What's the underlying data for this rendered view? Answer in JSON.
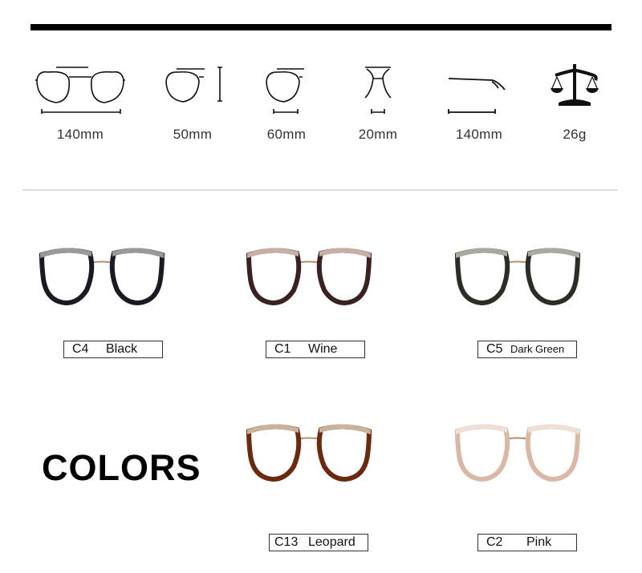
{
  "specs": [
    {
      "icon": "total-width-icon",
      "label": "140mm"
    },
    {
      "icon": "lens-height-icon",
      "label": "50mm"
    },
    {
      "icon": "lens-width-icon",
      "label": "60mm"
    },
    {
      "icon": "bridge-width-icon",
      "label": "20mm"
    },
    {
      "icon": "temple-length-icon",
      "label": "140mm"
    },
    {
      "icon": "weight-scale-icon",
      "label": "26g"
    }
  ],
  "heading": "COLORS",
  "variants": [
    {
      "code": "C4",
      "name": "Black",
      "frame": "#1a1a22",
      "brow": "#9a9a9a"
    },
    {
      "code": "C1",
      "name": "Wine",
      "frame": "#3b2222",
      "brow": "#c8b0a8"
    },
    {
      "code": "C5",
      "name": "Dark Green",
      "frame": "#2b2e26",
      "brow": "#a8aaa0"
    },
    {
      "code": "C13",
      "name": "Leopard",
      "frame": "#6a2a10",
      "brow": "#c9b39a"
    },
    {
      "code": "C2",
      "name": "Pink",
      "frame": "#d9b8a8",
      "brow": "#eee0d8"
    }
  ]
}
